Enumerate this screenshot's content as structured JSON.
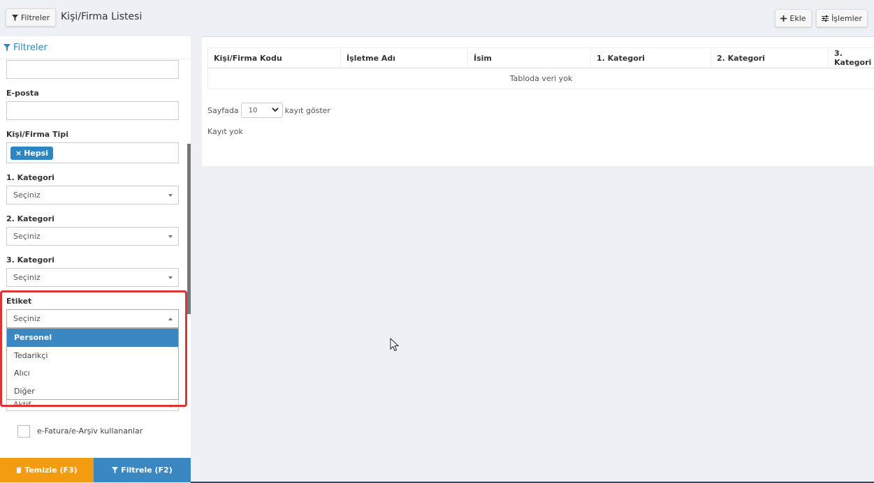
{
  "topbar": {
    "filters_button": "Filtreler",
    "title": "Kişi/Firma Listesi",
    "add_button": "Ekle",
    "operations_button": "İşlemler"
  },
  "sidebar": {
    "header": "Filtreler",
    "email_label": "E-posta",
    "type_label": "Kişi/Firma Tipi",
    "type_tag": "Hepsi",
    "category1_label": "1. Kategori",
    "category1_value": "Seçiniz",
    "category2_label": "2. Kategori",
    "category2_value": "Seçiniz",
    "category3_label": "3. Kategori",
    "category3_value": "Seçiniz",
    "tag_label": "Etiket",
    "tag_value": "Seçiniz",
    "tag_options": [
      "Personel",
      "Tedarikçi",
      "Alıcı",
      "Diğer"
    ],
    "status_value": "Aktif",
    "efatura_label": "e-Fatura/e-Arşiv kullananlar",
    "clear_button": "Temizle (F3)",
    "apply_button": "Filtrele (F2)"
  },
  "table": {
    "columns": [
      "Kişi/Firma Kodu",
      "İşletme Adı",
      "İsim",
      "1. Kategori",
      "2. Kategori",
      "3. Kategori"
    ],
    "empty_text": "Tabloda veri yok",
    "pager_prefix": "Sayfada",
    "pager_value": "10",
    "pager_suffix": "kayıt göster",
    "no_records": "Kayıt yok"
  },
  "colors": {
    "primary": "#3a87c2",
    "warning": "#f39c12",
    "highlight": "#e03434"
  }
}
